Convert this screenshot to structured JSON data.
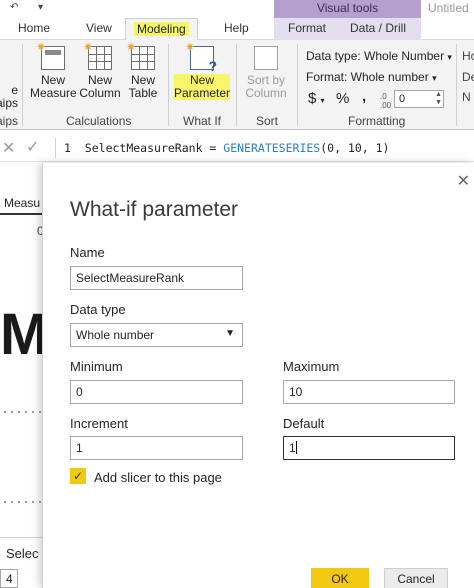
{
  "window": {
    "untitled": "Untitled"
  },
  "contextual": {
    "banner": "Visual tools",
    "tabs": [
      "Format",
      "Data / Drill"
    ]
  },
  "tabs": [
    "Home",
    "View",
    "Modeling",
    "Help"
  ],
  "active_tab": "Modeling",
  "ribbon": {
    "left_cut": {
      "btn1": "e",
      "btn2": "aips",
      "group": "aips"
    },
    "buttons": [
      {
        "line1": "New",
        "line2": "Measure",
        "icon": "new-measure-icon"
      },
      {
        "line1": "New",
        "line2": "Column",
        "icon": "new-column-icon"
      },
      {
        "line1": "New",
        "line2": "Table",
        "icon": "new-table-icon"
      },
      {
        "line1": "New",
        "line2": "Parameter",
        "icon": "new-parameter-icon"
      },
      {
        "line1": "Sort by",
        "line2": "Column",
        "icon": "sort-by-column-icon"
      }
    ],
    "groups": {
      "calculations": "Calculations",
      "whatif": "What If",
      "sort": "Sort",
      "formatting": "Formatting"
    },
    "formatting": {
      "data_type": "Data type: Whole Number",
      "format": "Format: Whole number",
      "currency": "$",
      "percent": "%",
      "comma": ",",
      "decimals": "0"
    },
    "right_cut": {
      "r1": "Ho",
      "r2": "De",
      "r3": "N"
    }
  },
  "formula": {
    "line_no": "1",
    "prefix": "SelectMeasureRank = ",
    "fn": "GENERATESERIES",
    "args": "(0, 10, 1)"
  },
  "background": {
    "tab": "Measu",
    "zero": "0",
    "big": "M",
    "select": "Selec",
    "four": "4"
  },
  "dialog": {
    "title": "What-if parameter",
    "name_label": "Name",
    "name_value": "SelectMeasureRank",
    "datatype_label": "Data type",
    "datatype_value": "Whole number",
    "min_label": "Minimum",
    "min_value": "0",
    "max_label": "Maximum",
    "max_value": "10",
    "inc_label": "Increment",
    "inc_value": "1",
    "def_label": "Default",
    "def_value": "1",
    "add_slicer_label": "Add slicer to this page",
    "add_slicer_checked": true,
    "ok": "OK",
    "cancel": "Cancel"
  },
  "colors": {
    "accent": "#f2c811",
    "highlight": "#f7f56a",
    "visual_tools": "#b4a0cf"
  }
}
